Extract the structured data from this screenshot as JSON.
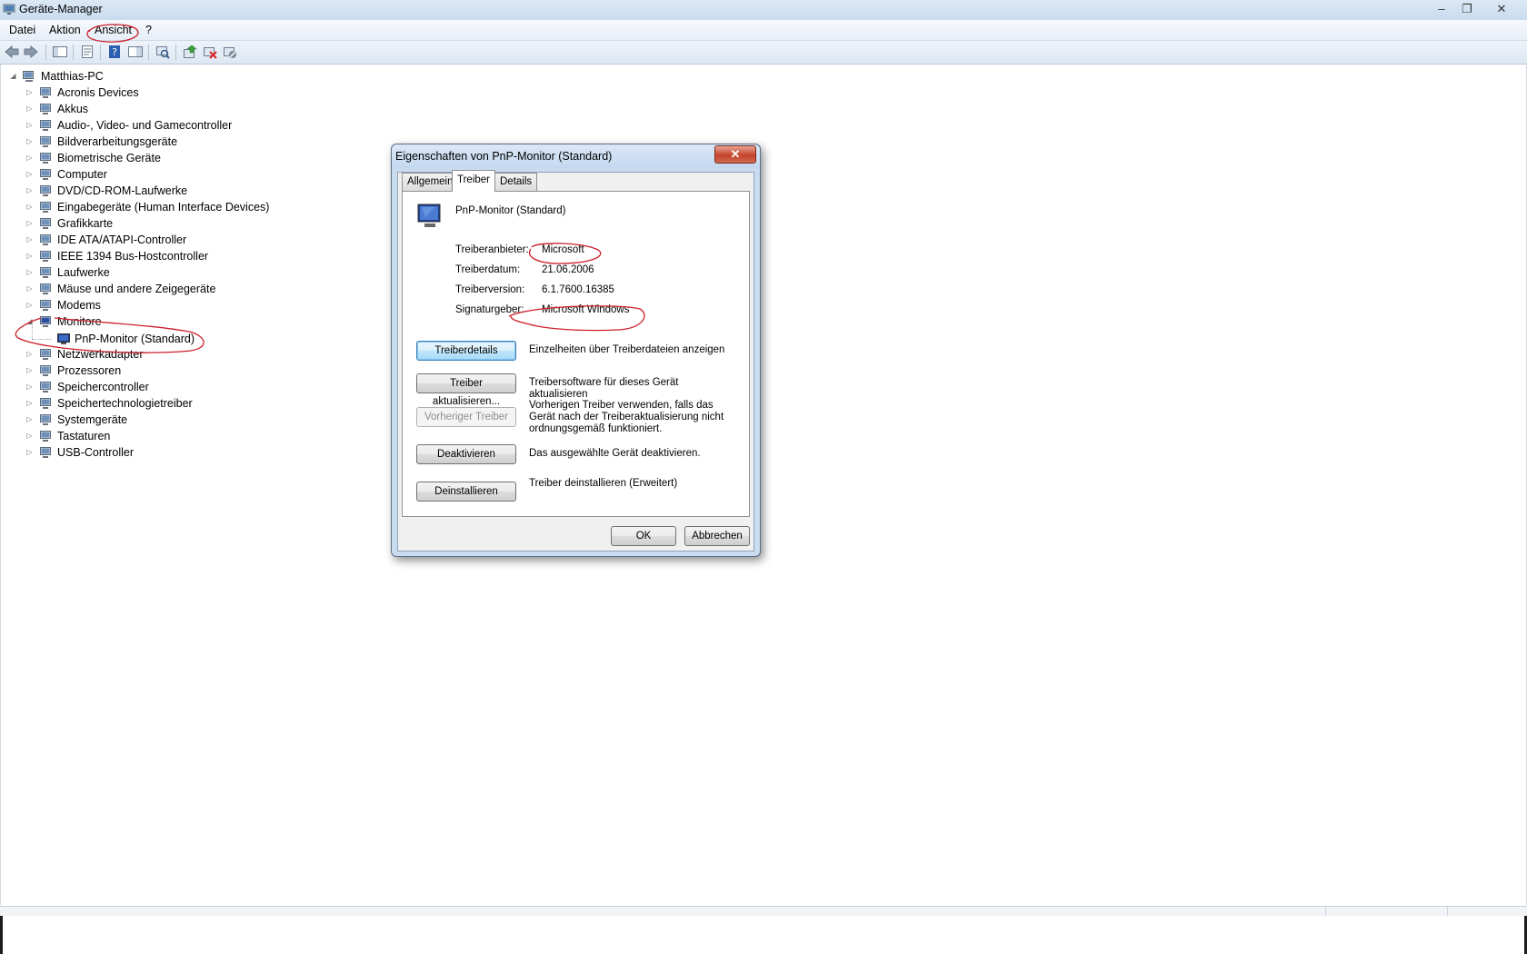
{
  "window": {
    "title": "Geräte-Manager",
    "minimize": "–",
    "maximize": "❐",
    "close": "✕"
  },
  "menu": [
    "Datei",
    "Aktion",
    "Ansicht",
    "?"
  ],
  "toolbar_icons": [
    "back-arrow-icon",
    "forward-arrow-icon",
    "show-hide-console-tree-icon",
    "properties-icon",
    "help-icon",
    "action-pane-icon",
    "scan-hardware-changes-icon",
    "update-driver-icon",
    "uninstall-device-icon",
    "disable-device-icon"
  ],
  "tree": {
    "root": "Matthias-PC",
    "categories": [
      {
        "label": "Acronis Devices",
        "icon": "acronis-device-icon",
        "expanded": false
      },
      {
        "label": "Akkus",
        "icon": "battery-icon",
        "expanded": false
      },
      {
        "label": "Audio-, Video- und Gamecontroller",
        "icon": "speaker-icon",
        "expanded": false
      },
      {
        "label": "Bildverarbeitungsgeräte",
        "icon": "camera-icon",
        "expanded": false
      },
      {
        "label": "Biometrische Geräte",
        "icon": "fingerprint-icon",
        "expanded": false
      },
      {
        "label": "Computer",
        "icon": "computer-icon",
        "expanded": false
      },
      {
        "label": "DVD/CD-ROM-Laufwerke",
        "icon": "disc-drive-icon",
        "expanded": false
      },
      {
        "label": "Eingabegeräte (Human Interface Devices)",
        "icon": "hid-icon",
        "expanded": false
      },
      {
        "label": "Grafikkarte",
        "icon": "display-adapter-icon",
        "expanded": false
      },
      {
        "label": "IDE ATA/ATAPI-Controller",
        "icon": "ide-controller-icon",
        "expanded": false
      },
      {
        "label": "IEEE 1394 Bus-Hostcontroller",
        "icon": "firewire-icon",
        "expanded": false
      },
      {
        "label": "Laufwerke",
        "icon": "hard-drive-icon",
        "expanded": false
      },
      {
        "label": "Mäuse und andere Zeigegeräte",
        "icon": "mouse-icon",
        "expanded": false
      },
      {
        "label": "Modems",
        "icon": "modem-icon",
        "expanded": false
      },
      {
        "label": "Monitore",
        "icon": "monitor-icon",
        "expanded": true
      },
      {
        "label": "Netzwerkadapter",
        "icon": "network-adapter-icon",
        "expanded": false
      },
      {
        "label": "Prozessoren",
        "icon": "processor-icon",
        "expanded": false
      },
      {
        "label": "Speichercontroller",
        "icon": "storage-controller-icon",
        "expanded": false
      },
      {
        "label": "Speichertechnologietreiber",
        "icon": "storage-tech-icon",
        "expanded": false
      },
      {
        "label": "Systemgeräte",
        "icon": "system-device-icon",
        "expanded": false
      },
      {
        "label": "Tastaturen",
        "icon": "keyboard-icon",
        "expanded": false
      },
      {
        "label": "USB-Controller",
        "icon": "usb-icon",
        "expanded": false
      }
    ],
    "monitor_child": "PnP-Monitor (Standard)"
  },
  "dialog": {
    "title": "Eigenschaften von PnP-Monitor (Standard)",
    "close": "✕",
    "tabs": [
      "Allgemein",
      "Treiber",
      "Details"
    ],
    "active_tab": "Treiber",
    "device_name": "PnP-Monitor (Standard)",
    "fields": [
      {
        "label": "Treiberanbieter:",
        "value": "Microsoft"
      },
      {
        "label": "Treiberdatum:",
        "value": "21.06.2006"
      },
      {
        "label": "Treiberversion:",
        "value": "6.1.7600.16385"
      },
      {
        "label": "Signaturgeber:",
        "value": "Microsoft Windows"
      }
    ],
    "actions": [
      {
        "button": "Treiberdetails",
        "desc": "Einzelheiten über Treiberdateien anzeigen",
        "state": "focused"
      },
      {
        "button": "Treiber aktualisieren...",
        "desc": "Treibersoftware für dieses Gerät aktualisieren",
        "state": "normal"
      },
      {
        "button": "Vorheriger Treiber",
        "desc": "Vorherigen Treiber verwenden, falls das Gerät nach der Treiberaktualisierung nicht ordnungsgemäß funktioniert.",
        "state": "disabled"
      },
      {
        "button": "Deaktivieren",
        "desc": "Das ausgewählte Gerät deaktivieren.",
        "state": "normal"
      },
      {
        "button": "Deinstallieren",
        "desc": "Treiber deinstallieren (Erweitert)",
        "state": "normal"
      }
    ],
    "ok": "OK",
    "cancel": "Abbrechen"
  },
  "annotation_color": "#cc1f2a"
}
